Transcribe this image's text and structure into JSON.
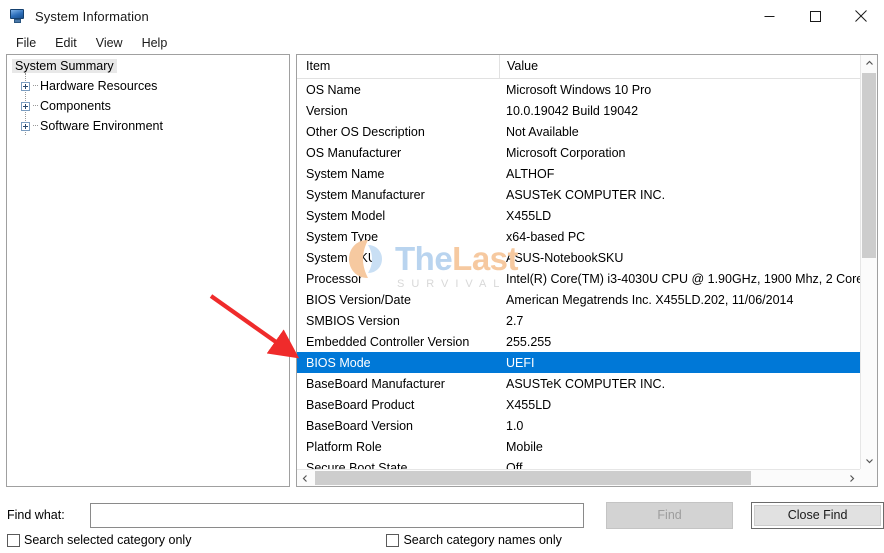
{
  "window": {
    "title": "System Information",
    "icon": "computer-icon",
    "controls": {
      "minimize": "minimize-icon",
      "maximize": "maximize-icon",
      "close": "close-icon"
    }
  },
  "menu": {
    "items": [
      {
        "label": "File"
      },
      {
        "label": "Edit"
      },
      {
        "label": "View"
      },
      {
        "label": "Help"
      }
    ]
  },
  "tree": {
    "root": {
      "label": "System Summary",
      "selected": true
    },
    "children": [
      {
        "label": "Hardware Resources"
      },
      {
        "label": "Components"
      },
      {
        "label": "Software Environment"
      }
    ]
  },
  "list": {
    "columns": {
      "item": "Item",
      "value": "Value"
    },
    "rows": [
      {
        "item": "OS Name",
        "value": "Microsoft Windows 10 Pro"
      },
      {
        "item": "Version",
        "value": "10.0.19042 Build 19042"
      },
      {
        "item": "Other OS Description",
        "value": "Not Available"
      },
      {
        "item": "OS Manufacturer",
        "value": "Microsoft Corporation"
      },
      {
        "item": "System Name",
        "value": "ALTHOF"
      },
      {
        "item": "System Manufacturer",
        "value": "ASUSTeK COMPUTER INC."
      },
      {
        "item": "System Model",
        "value": "X455LD"
      },
      {
        "item": "System Type",
        "value": "x64-based PC"
      },
      {
        "item": "System SKU",
        "value": "ASUS-NotebookSKU"
      },
      {
        "item": "Processor",
        "value": "Intel(R) Core(TM) i3-4030U CPU @ 1.90GHz, 1900 Mhz, 2 Core"
      },
      {
        "item": "BIOS Version/Date",
        "value": "American Megatrends Inc. X455LD.202, 11/06/2014"
      },
      {
        "item": "SMBIOS Version",
        "value": "2.7"
      },
      {
        "item": "Embedded Controller Version",
        "value": "255.255"
      },
      {
        "item": "BIOS Mode",
        "value": "UEFI",
        "selected": true
      },
      {
        "item": "BaseBoard Manufacturer",
        "value": "ASUSTeK COMPUTER INC."
      },
      {
        "item": "BaseBoard Product",
        "value": "X455LD"
      },
      {
        "item": "BaseBoard Version",
        "value": "1.0"
      },
      {
        "item": "Platform Role",
        "value": "Mobile"
      },
      {
        "item": "Secure Boot State",
        "value": "Off"
      }
    ],
    "selection_color": "#0078d7"
  },
  "scrollbars": {
    "vertical": {
      "up": "chevron-up-icon",
      "down": "chevron-down-icon"
    },
    "horizontal": {
      "left": "chevron-left-icon",
      "right": "chevron-right-icon"
    }
  },
  "find": {
    "label": "Find what:",
    "input_value": "",
    "input_placeholder": "",
    "find_button": "Find",
    "find_button_enabled": false,
    "close_button": "Close Find",
    "checkbox_selected_category": "Search selected category only",
    "checkbox_category_names": "Search category names only",
    "checked_selected_category": false,
    "checked_category_names": false
  },
  "watermark": {
    "text_the": "The",
    "text_last": "Last",
    "subtitle": "SURVIVAL"
  },
  "annotation": {
    "arrow_color": "#ef2b2b",
    "points_to": "BIOS Mode"
  }
}
